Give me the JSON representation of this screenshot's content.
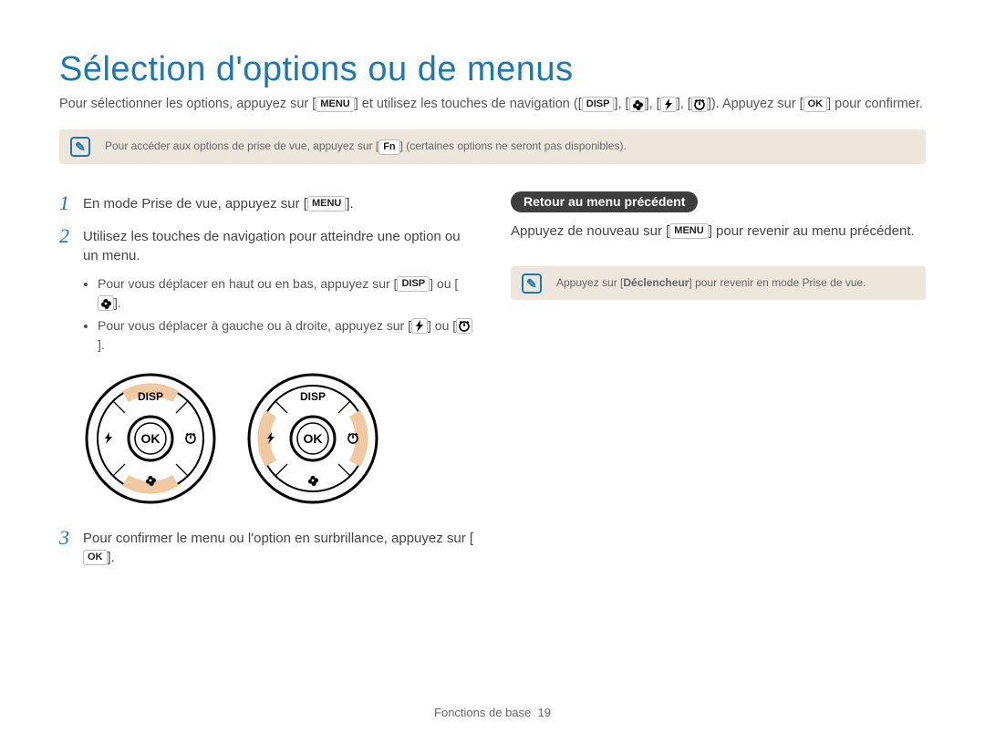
{
  "title": "Sélection d'options ou de menus",
  "intro": {
    "part1": "Pour sélectionner les options, appuyez sur [",
    "menu_btn": "MENU",
    "part2": "] et utilisez les touches de navigation ([",
    "disp_btn": "DISP",
    "part3": "], [",
    "part4": "], [",
    "part5": "], [",
    "part6": "]). Appuyez sur [",
    "ok_btn": "OK",
    "part7": "] pour confirmer."
  },
  "note1": {
    "part1": "Pour accéder aux options de prise de vue, appuyez sur [",
    "fn_btn": "Fn",
    "part2": "] (certaines options ne seront pas disponibles)."
  },
  "steps": {
    "s1": {
      "num": "1",
      "a": "En mode Prise de vue, appuyez sur [",
      "btn": "MENU",
      "b": "]."
    },
    "s2": {
      "num": "2",
      "a": "Utilisez les touches de navigation pour atteindre une option ou un menu.",
      "bullets": {
        "b1a": "Pour vous déplacer en haut ou en bas, appuyez sur [",
        "b1_disp": "DISP",
        "b1b": "] ou [",
        "b1c": "].",
        "b2a": "Pour vous déplacer à gauche ou à droite, appuyez sur [",
        "b2b": "] ou [",
        "b2c": "]."
      }
    },
    "s3": {
      "num": "3",
      "a": "Pour confirmer le menu ou l'option en surbrillance, appuyez sur [",
      "btn": "OK",
      "b": "]."
    }
  },
  "dial_labels": {
    "disp": "DISP",
    "ok": "OK"
  },
  "right": {
    "pill": "Retour au menu précédent",
    "text_a": "Appuyez de nouveau sur [",
    "text_btn": "MENU",
    "text_b": "] pour revenir au menu précédent.",
    "note_a": "Appuyez sur [",
    "note_bold": "Déclencheur",
    "note_b": "] pour revenir en mode Prise de vue."
  },
  "footer": {
    "label": "Fonctions de base",
    "page": "19"
  }
}
